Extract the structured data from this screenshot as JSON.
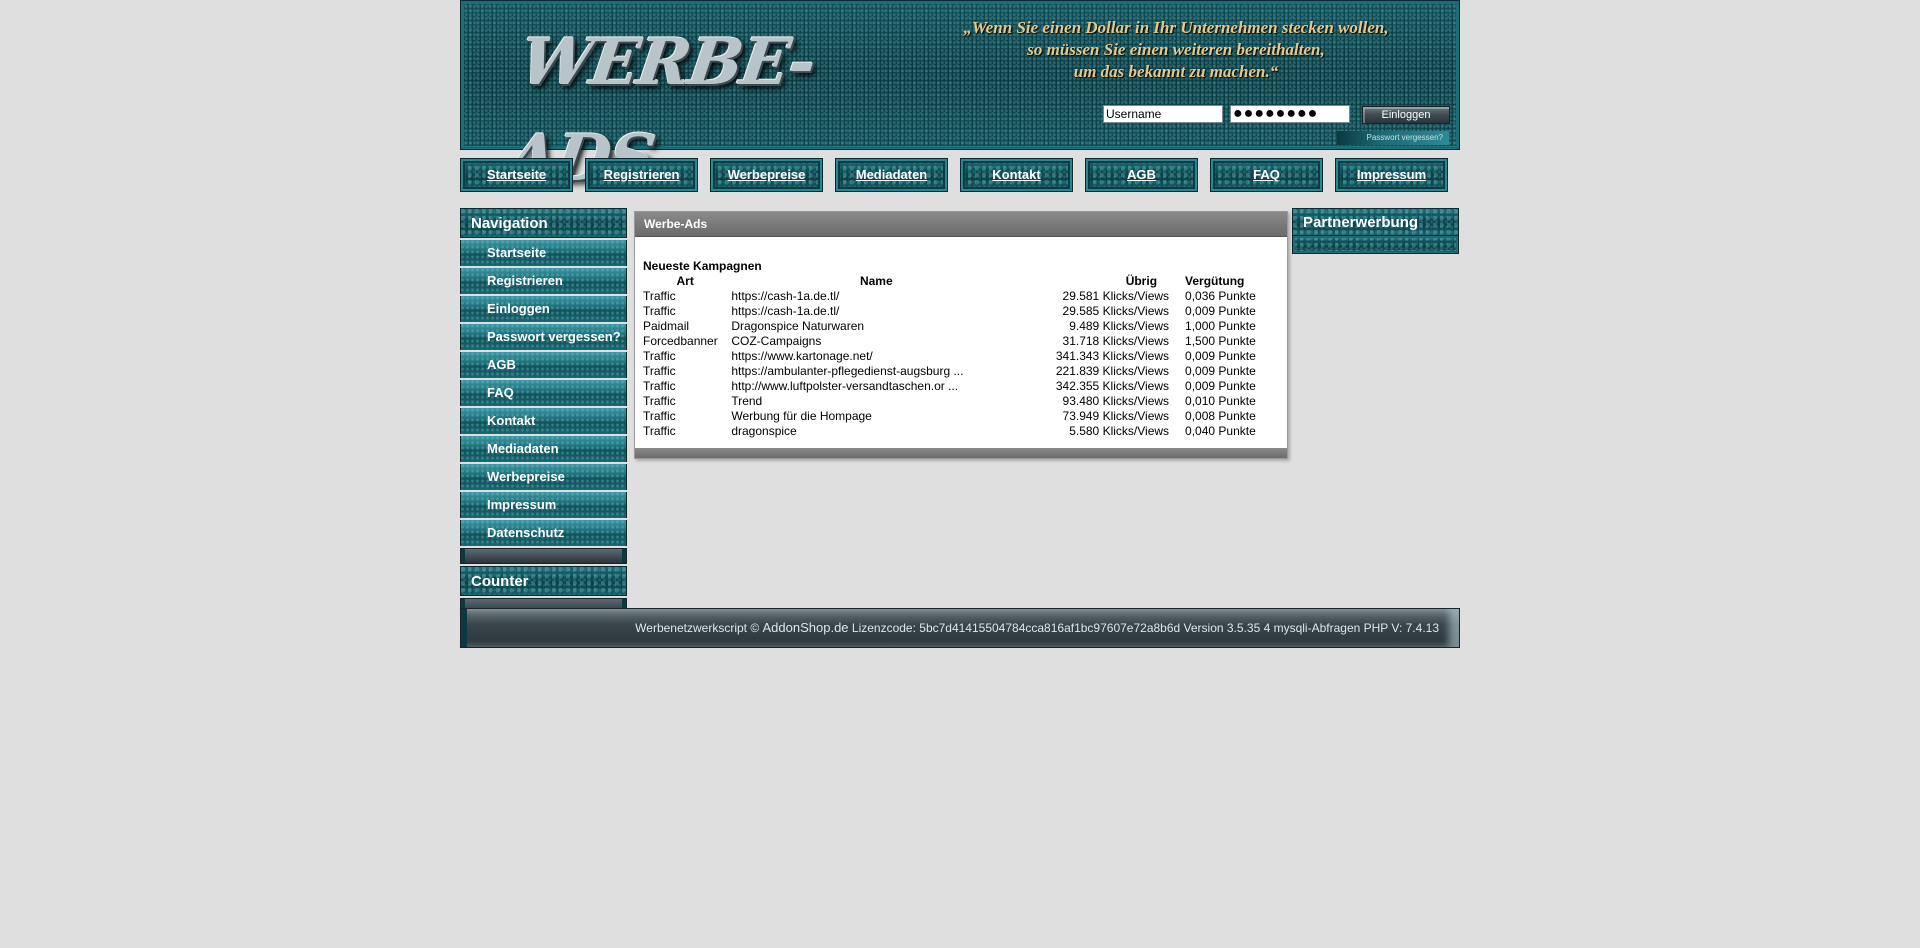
{
  "header": {
    "logo_text": "WERBE-ADS",
    "quote_lines": [
      "„Wenn Sie einen Dollar in Ihr Unternehmen stecken wollen,",
      "so müssen Sie einen weiteren bereithalten,",
      "um das bekannt zu machen.“"
    ],
    "username_value": "Username",
    "password_value": "●●●●●●●●",
    "login_button": "Einloggen",
    "forgot_link": "Passwort vergessen?"
  },
  "topnav": [
    "Startseite",
    "Registrieren",
    "Werbepreise",
    "Mediadaten",
    "Kontakt",
    "AGB",
    "FAQ",
    "Impressum"
  ],
  "sidebar": {
    "title": "Navigation",
    "items": [
      "Startseite",
      "Registrieren",
      "Einloggen",
      "Passwort vergessen?",
      "AGB",
      "FAQ",
      "Kontakt",
      "Mediadaten",
      "Werbepreise",
      "Impressum",
      "Datenschutz"
    ],
    "counter_title": "Counter"
  },
  "main": {
    "title": "Werbe-Ads",
    "section_title": "Neueste Kampagnen",
    "columns": [
      "Art",
      "Name",
      "Übrig",
      "Vergütung"
    ],
    "rows": [
      [
        "Traffic",
        "https://cash-1a.de.tl/",
        "29.581 Klicks/Views",
        "0,036 Punkte"
      ],
      [
        "Traffic",
        "https://cash-1a.de.tl/",
        "29.585 Klicks/Views",
        "0,009 Punkte"
      ],
      [
        "Paidmail",
        "Dragonspice Naturwaren",
        "9.489 Klicks/Views",
        "1,000 Punkte"
      ],
      [
        "Forcedbanner",
        "COZ-Campaigns",
        "31.718 Klicks/Views",
        "1,500 Punkte"
      ],
      [
        "Traffic",
        "https://www.kartonage.net/",
        "341.343 Klicks/Views",
        "0,009 Punkte"
      ],
      [
        "Traffic",
        "https://ambulanter-pflegedienst-augsburg ...",
        "221.839 Klicks/Views",
        "0,009 Punkte"
      ],
      [
        "Traffic",
        "http://www.luftpolster-versandtaschen.or ...",
        "342.355 Klicks/Views",
        "0,009 Punkte"
      ],
      [
        "Traffic",
        "Trend",
        "93.480 Klicks/Views",
        "0,010 Punkte"
      ],
      [
        "Traffic",
        "Werbung für die Hompage",
        "73.949 Klicks/Views",
        "0,008 Punkte"
      ],
      [
        "Traffic",
        "dragonspice",
        "5.580 Klicks/Views",
        "0,040 Punkte"
      ]
    ]
  },
  "partner": {
    "title": "Partnerwerbung"
  },
  "footer": {
    "script_text": "Werbenetzwerkscript ©",
    "shop": "AddonShop.de",
    "rest": " Lizenzcode: 5bc7d41415504784cca816af1bc97607e72a8b6d Version 3.5.35  4 mysqli-Abfragen   PHP V: 7.4.13"
  }
}
